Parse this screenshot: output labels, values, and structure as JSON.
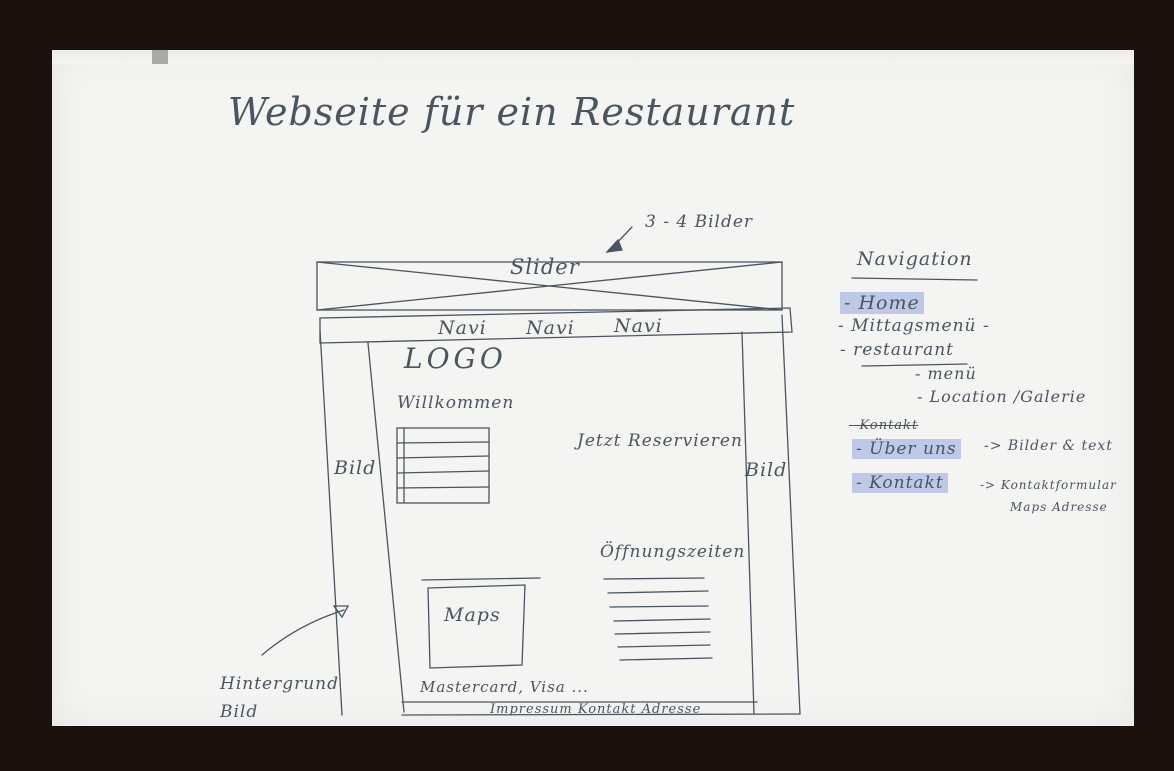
{
  "title": "Webseite für ein Restaurant",
  "slider_note": "3 - 4 Bilder",
  "wireframe": {
    "slider": "Slider",
    "nav_items": [
      "Navi",
      "Navi",
      "Navi"
    ],
    "logo": "LOGO",
    "welcome": "Willkommen",
    "reserve": "Jetzt Reservieren",
    "image_left": "Bild",
    "image_right": "Bild",
    "hours": "Öffnungszeiten",
    "maps": "Maps",
    "payment": "Mastercard, Visa ...",
    "footer": "Impressum Kontakt Adresse"
  },
  "background_note": "Hintergrund Bild",
  "navigation": {
    "heading": "Navigation",
    "items": [
      {
        "label": "- Home"
      },
      {
        "label": "- Mittagsmenü -"
      },
      {
        "label": "- restaurant"
      },
      {
        "label": "- menü"
      },
      {
        "label": "- Location /Galerie"
      },
      {
        "label": "- Kontakt"
      },
      {
        "label": "- Über uns"
      },
      {
        "label": "- Kontakt"
      }
    ],
    "about_arrow": "-> Bilder & text",
    "contact_arrow": "-> Kontaktformular",
    "contact_arrow_2": "Maps Adresse"
  },
  "colors": {
    "ink": "#4a5560",
    "highlight": "#8fa5dc",
    "frame": "#1c110c",
    "paper": "#f4f4f2"
  }
}
